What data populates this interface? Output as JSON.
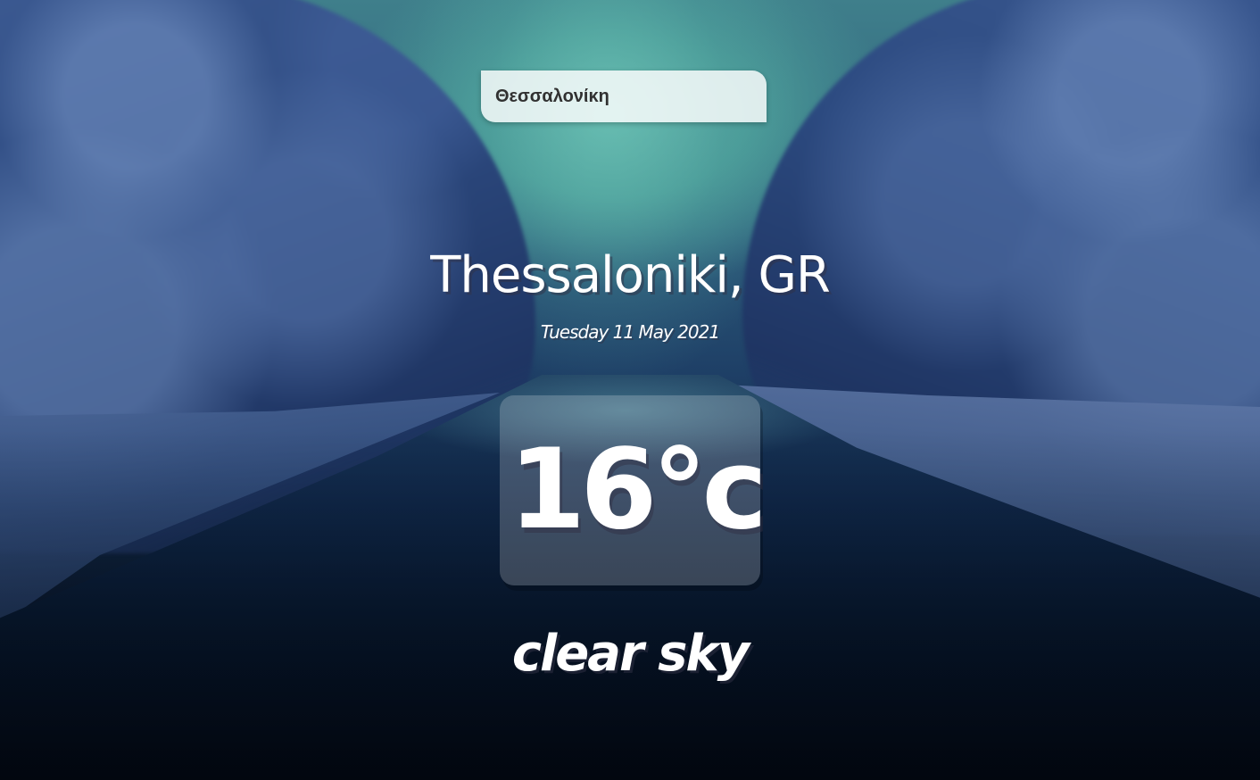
{
  "search": {
    "value": "Θεσσαλονίκη"
  },
  "location": {
    "place": "Thessaloniki, GR",
    "date": "Tuesday 11 May 2021"
  },
  "weather": {
    "temperature": "16°c",
    "description": "clear sky"
  },
  "background": {
    "scene": "snowy-river-forest"
  }
}
